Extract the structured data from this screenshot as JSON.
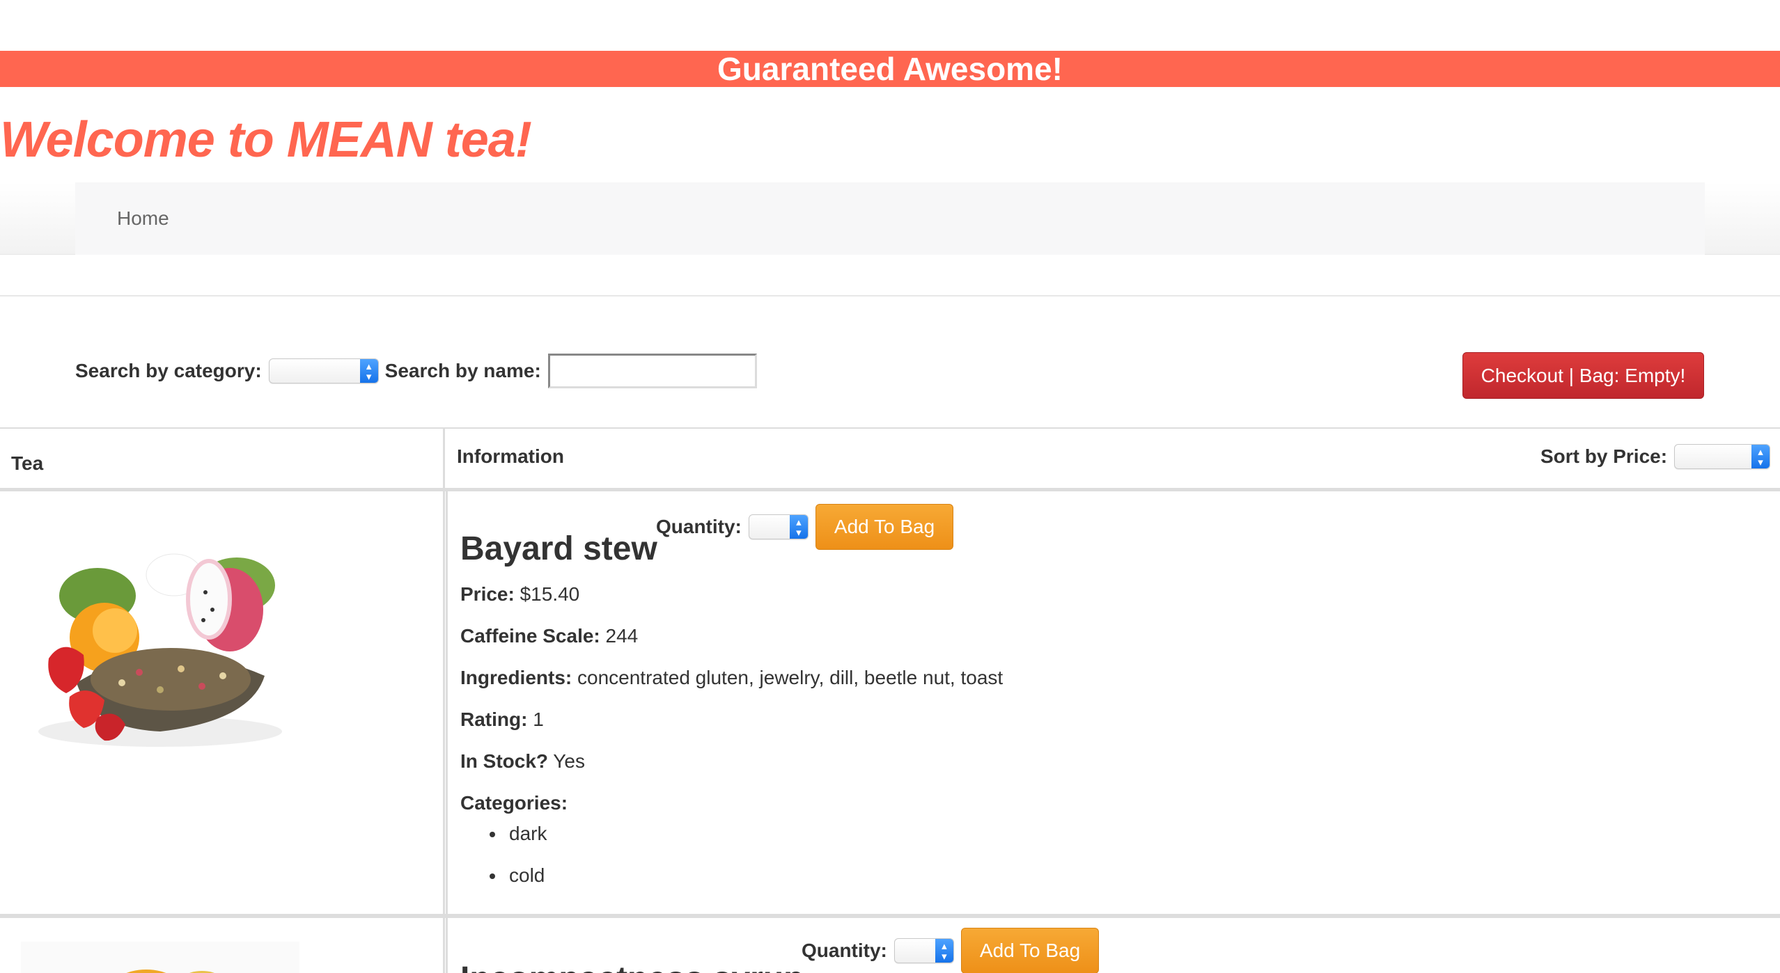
{
  "banner": {
    "text": "Guaranteed Awesome!"
  },
  "welcome": {
    "title": "Welcome to MEAN tea!"
  },
  "nav": {
    "home": "Home"
  },
  "search": {
    "category_label": "Search by category:",
    "category_value": "",
    "name_label": "Search by name:",
    "name_value": ""
  },
  "checkout": {
    "label": "Checkout | Bag: Empty!"
  },
  "table": {
    "headers": {
      "tea": "Tea",
      "information": "Information"
    },
    "sort_label": "Sort by Price:",
    "sort_value": ""
  },
  "products": [
    {
      "name": "Bayard stew",
      "quantity_label": "Quantity:",
      "add_label": "Add To Bag",
      "price_label": "Price:",
      "price": "$15.40",
      "caffeine_label": "Caffeine Scale:",
      "caffeine": "244",
      "ingredients_label": "Ingredients:",
      "ingredients": "concentrated gluten, jewelry, dill, beetle nut, toast",
      "rating_label": "Rating:",
      "rating": "1",
      "stock_label": "In Stock?",
      "stock": "Yes",
      "categories_label": "Categories:",
      "categories": [
        "dark",
        "cold"
      ]
    },
    {
      "name": "Incompactness syrup",
      "quantity_label": "Quantity:",
      "add_label": "Add To Bag"
    }
  ],
  "colors": {
    "brand": "#ff6650",
    "checkout": "#c8272d",
    "add_button": "#f0961c",
    "select_arrow": "#1f7ff0"
  }
}
